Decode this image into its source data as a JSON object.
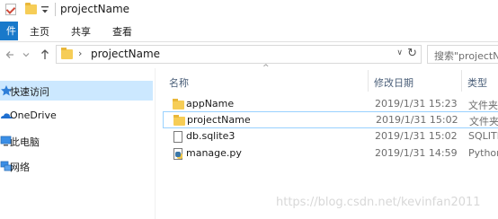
{
  "window": {
    "title": "projectName",
    "quick_access": [
      {
        "icon": "properties-check-icon"
      },
      {
        "icon": "new-folder-icon"
      },
      {
        "icon": "customize-dropdown-icon"
      }
    ]
  },
  "ribbon": {
    "tabs": [
      {
        "label": "件",
        "active": true
      },
      {
        "label": "主页"
      },
      {
        "label": "共享"
      },
      {
        "label": "查看"
      }
    ]
  },
  "address_bar": {
    "back_icon": "back-arrow-icon",
    "forward_icon": "forward-arrow-icon",
    "up_icon": "up-arrow-icon",
    "path_chevron": "›",
    "path": "projectName",
    "dropdown_glyph": "∨",
    "refresh_glyph": "↻"
  },
  "search": {
    "placeholder": "搜索\"projectN"
  },
  "nav_pane": {
    "items": [
      {
        "label": "快速访问",
        "icon": "star-icon",
        "selected": true
      },
      {
        "label": "OneDrive",
        "icon": "cloud-icon"
      },
      {
        "label": "此电脑",
        "icon": "computer-icon"
      },
      {
        "label": "网络",
        "icon": "network-icon"
      }
    ]
  },
  "file_list": {
    "columns": {
      "name": "名称",
      "date": "修改日期",
      "type": "类型"
    },
    "sort_caret": "^",
    "rows": [
      {
        "name": "appName",
        "date": "2019/1/31 15:23",
        "type": "文件夹",
        "icon": "folder-icon"
      },
      {
        "name": "projectName",
        "date": "2019/1/31 15:02",
        "type": "文件夹",
        "icon": "folder-icon",
        "selected": true
      },
      {
        "name": "db.sqlite3",
        "date": "2019/1/31 15:02",
        "type": "SQLITE",
        "icon": "file-icon"
      },
      {
        "name": "manage.py",
        "date": "2019/1/31 14:59",
        "type": "Python",
        "icon": "python-file-icon"
      }
    ]
  },
  "watermark": "https://blog.csdn.net/kevinfan2011",
  "colors": {
    "accent": "#1979ca",
    "selection": "#cce8ff",
    "selection_border": "#99d1ff",
    "folder": "#f6cd57"
  }
}
